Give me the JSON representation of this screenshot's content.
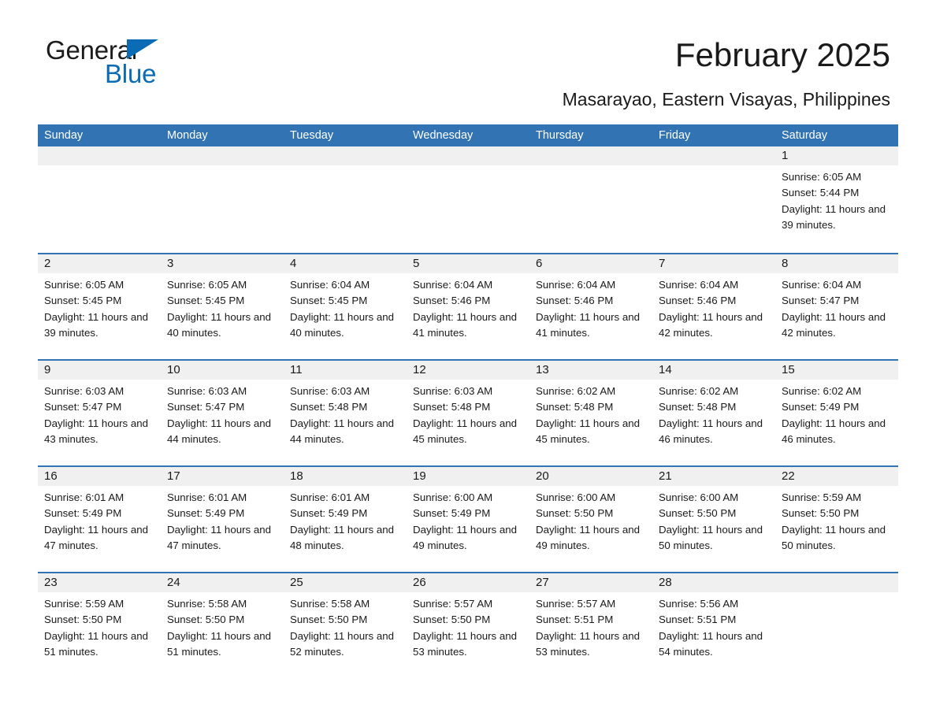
{
  "brand": {
    "name_part1": "General",
    "name_part2": "Blue",
    "logo_icon": "triangle-logo",
    "accent_color": "#0b6cb5"
  },
  "header": {
    "title": "February 2025",
    "subtitle": "Masarayao, Eastern Visayas, Philippines",
    "header_bg_color": "#3173b3",
    "date_strip_color": "#f0f0f0"
  },
  "weekdays": [
    "Sunday",
    "Monday",
    "Tuesday",
    "Wednesday",
    "Thursday",
    "Friday",
    "Saturday"
  ],
  "weeks": [
    [
      {
        "day": "",
        "sunrise": "",
        "sunset": "",
        "daylight": "",
        "empty": true
      },
      {
        "day": "",
        "sunrise": "",
        "sunset": "",
        "daylight": "",
        "empty": true
      },
      {
        "day": "",
        "sunrise": "",
        "sunset": "",
        "daylight": "",
        "empty": true
      },
      {
        "day": "",
        "sunrise": "",
        "sunset": "",
        "daylight": "",
        "empty": true
      },
      {
        "day": "",
        "sunrise": "",
        "sunset": "",
        "daylight": "",
        "empty": true
      },
      {
        "day": "",
        "sunrise": "",
        "sunset": "",
        "daylight": "",
        "empty": true
      },
      {
        "day": "1",
        "sunrise": "Sunrise: 6:05 AM",
        "sunset": "Sunset: 5:44 PM",
        "daylight": "Daylight: 11 hours and 39 minutes."
      }
    ],
    [
      {
        "day": "2",
        "sunrise": "Sunrise: 6:05 AM",
        "sunset": "Sunset: 5:45 PM",
        "daylight": "Daylight: 11 hours and 39 minutes."
      },
      {
        "day": "3",
        "sunrise": "Sunrise: 6:05 AM",
        "sunset": "Sunset: 5:45 PM",
        "daylight": "Daylight: 11 hours and 40 minutes."
      },
      {
        "day": "4",
        "sunrise": "Sunrise: 6:04 AM",
        "sunset": "Sunset: 5:45 PM",
        "daylight": "Daylight: 11 hours and 40 minutes."
      },
      {
        "day": "5",
        "sunrise": "Sunrise: 6:04 AM",
        "sunset": "Sunset: 5:46 PM",
        "daylight": "Daylight: 11 hours and 41 minutes."
      },
      {
        "day": "6",
        "sunrise": "Sunrise: 6:04 AM",
        "sunset": "Sunset: 5:46 PM",
        "daylight": "Daylight: 11 hours and 41 minutes."
      },
      {
        "day": "7",
        "sunrise": "Sunrise: 6:04 AM",
        "sunset": "Sunset: 5:46 PM",
        "daylight": "Daylight: 11 hours and 42 minutes."
      },
      {
        "day": "8",
        "sunrise": "Sunrise: 6:04 AM",
        "sunset": "Sunset: 5:47 PM",
        "daylight": "Daylight: 11 hours and 42 minutes."
      }
    ],
    [
      {
        "day": "9",
        "sunrise": "Sunrise: 6:03 AM",
        "sunset": "Sunset: 5:47 PM",
        "daylight": "Daylight: 11 hours and 43 minutes."
      },
      {
        "day": "10",
        "sunrise": "Sunrise: 6:03 AM",
        "sunset": "Sunset: 5:47 PM",
        "daylight": "Daylight: 11 hours and 44 minutes."
      },
      {
        "day": "11",
        "sunrise": "Sunrise: 6:03 AM",
        "sunset": "Sunset: 5:48 PM",
        "daylight": "Daylight: 11 hours and 44 minutes."
      },
      {
        "day": "12",
        "sunrise": "Sunrise: 6:03 AM",
        "sunset": "Sunset: 5:48 PM",
        "daylight": "Daylight: 11 hours and 45 minutes."
      },
      {
        "day": "13",
        "sunrise": "Sunrise: 6:02 AM",
        "sunset": "Sunset: 5:48 PM",
        "daylight": "Daylight: 11 hours and 45 minutes."
      },
      {
        "day": "14",
        "sunrise": "Sunrise: 6:02 AM",
        "sunset": "Sunset: 5:48 PM",
        "daylight": "Daylight: 11 hours and 46 minutes."
      },
      {
        "day": "15",
        "sunrise": "Sunrise: 6:02 AM",
        "sunset": "Sunset: 5:49 PM",
        "daylight": "Daylight: 11 hours and 46 minutes."
      }
    ],
    [
      {
        "day": "16",
        "sunrise": "Sunrise: 6:01 AM",
        "sunset": "Sunset: 5:49 PM",
        "daylight": "Daylight: 11 hours and 47 minutes."
      },
      {
        "day": "17",
        "sunrise": "Sunrise: 6:01 AM",
        "sunset": "Sunset: 5:49 PM",
        "daylight": "Daylight: 11 hours and 47 minutes."
      },
      {
        "day": "18",
        "sunrise": "Sunrise: 6:01 AM",
        "sunset": "Sunset: 5:49 PM",
        "daylight": "Daylight: 11 hours and 48 minutes."
      },
      {
        "day": "19",
        "sunrise": "Sunrise: 6:00 AM",
        "sunset": "Sunset: 5:49 PM",
        "daylight": "Daylight: 11 hours and 49 minutes."
      },
      {
        "day": "20",
        "sunrise": "Sunrise: 6:00 AM",
        "sunset": "Sunset: 5:50 PM",
        "daylight": "Daylight: 11 hours and 49 minutes."
      },
      {
        "day": "21",
        "sunrise": "Sunrise: 6:00 AM",
        "sunset": "Sunset: 5:50 PM",
        "daylight": "Daylight: 11 hours and 50 minutes."
      },
      {
        "day": "22",
        "sunrise": "Sunrise: 5:59 AM",
        "sunset": "Sunset: 5:50 PM",
        "daylight": "Daylight: 11 hours and 50 minutes."
      }
    ],
    [
      {
        "day": "23",
        "sunrise": "Sunrise: 5:59 AM",
        "sunset": "Sunset: 5:50 PM",
        "daylight": "Daylight: 11 hours and 51 minutes."
      },
      {
        "day": "24",
        "sunrise": "Sunrise: 5:58 AM",
        "sunset": "Sunset: 5:50 PM",
        "daylight": "Daylight: 11 hours and 51 minutes."
      },
      {
        "day": "25",
        "sunrise": "Sunrise: 5:58 AM",
        "sunset": "Sunset: 5:50 PM",
        "daylight": "Daylight: 11 hours and 52 minutes."
      },
      {
        "day": "26",
        "sunrise": "Sunrise: 5:57 AM",
        "sunset": "Sunset: 5:50 PM",
        "daylight": "Daylight: 11 hours and 53 minutes."
      },
      {
        "day": "27",
        "sunrise": "Sunrise: 5:57 AM",
        "sunset": "Sunset: 5:51 PM",
        "daylight": "Daylight: 11 hours and 53 minutes."
      },
      {
        "day": "28",
        "sunrise": "Sunrise: 5:56 AM",
        "sunset": "Sunset: 5:51 PM",
        "daylight": "Daylight: 11 hours and 54 minutes."
      },
      {
        "day": "",
        "sunrise": "",
        "sunset": "",
        "daylight": "",
        "blank": true
      }
    ]
  ]
}
